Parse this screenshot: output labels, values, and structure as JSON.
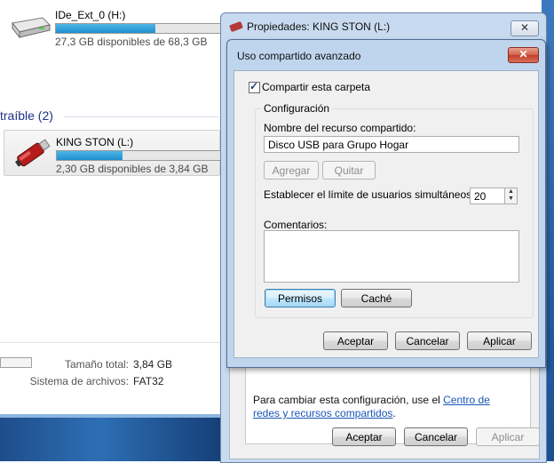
{
  "explorer": {
    "drives": [
      {
        "name": "IDe_Ext_0 (H:)",
        "free": "27,3 GB disponibles de 68,3 GB",
        "fill": 0.6
      },
      {
        "name": "KING STON (L:)",
        "free": "2,30 GB disponibles de 3,84 GB",
        "fill": 0.4
      }
    ],
    "section_title": "traíble (2)",
    "details": {
      "total_label": "Tamaño total:",
      "total_value": "3,84 GB",
      "fs_label": "Sistema de archivos:",
      "fs_value": "FAT32"
    }
  },
  "back_dialog": {
    "title": "Propiedades: KING STON (L:)",
    "close_label": "✕",
    "info_text": "Para cambiar esta configuración, use el ",
    "info_link": "Centro de redes y recursos compartidos",
    "info_end": ".",
    "buttons": {
      "ok": "Aceptar",
      "cancel": "Cancelar",
      "apply": "Aplicar"
    }
  },
  "front_dialog": {
    "title": "Uso compartido avanzado",
    "close_label": "✕",
    "share_checkbox_label": "Compartir esta carpeta",
    "share_checked": true,
    "group_title": "Configuración",
    "share_name_label": "Nombre del recurso compartido:",
    "share_name_value": "Disco USB para Grupo Hogar",
    "add_label": "Agregar",
    "remove_label": "Quitar",
    "limit_label": "Establecer el límite de usuarios simultáneos en:",
    "limit_value": "20",
    "comments_label": "Comentarios:",
    "permissions_label": "Permisos",
    "cache_label": "Caché",
    "buttons": {
      "ok": "Aceptar",
      "cancel": "Cancelar",
      "apply": "Aplicar"
    }
  },
  "colors": {
    "accent": "#1f8fcf",
    "link": "#1a56b8",
    "close_red": "#c0402a"
  }
}
